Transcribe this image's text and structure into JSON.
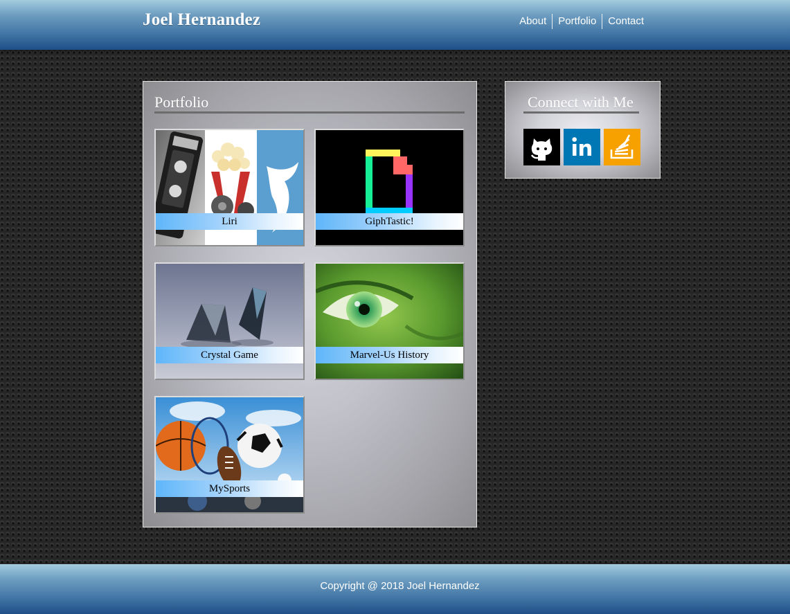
{
  "header": {
    "brand": "Joel Hernandez"
  },
  "nav": {
    "items": [
      "About",
      "Portfolio",
      "Contact"
    ]
  },
  "portfolio": {
    "title": "Portfolio",
    "projects": [
      {
        "name": "Liri",
        "thumbnail": "liri-collage-image"
      },
      {
        "name": "GiphTastic!",
        "thumbnail": "giphy-logo-image"
      },
      {
        "name": "Crystal Game",
        "thumbnail": "crystals-image"
      },
      {
        "name": "Marvel-Us History",
        "thumbnail": "hulk-eye-image"
      },
      {
        "name": "MySports",
        "thumbnail": "sports-balls-image"
      }
    ]
  },
  "connect": {
    "title": "Connect with Me",
    "links": [
      {
        "icon": "github-icon",
        "color": "#000000"
      },
      {
        "icon": "linkedin-icon",
        "color": "#0077b5"
      },
      {
        "icon": "stackoverflow-icon",
        "color": "#f7a100"
      }
    ]
  },
  "footer": {
    "copyright": "Copyright @ 2018 Joel Hernandez"
  }
}
